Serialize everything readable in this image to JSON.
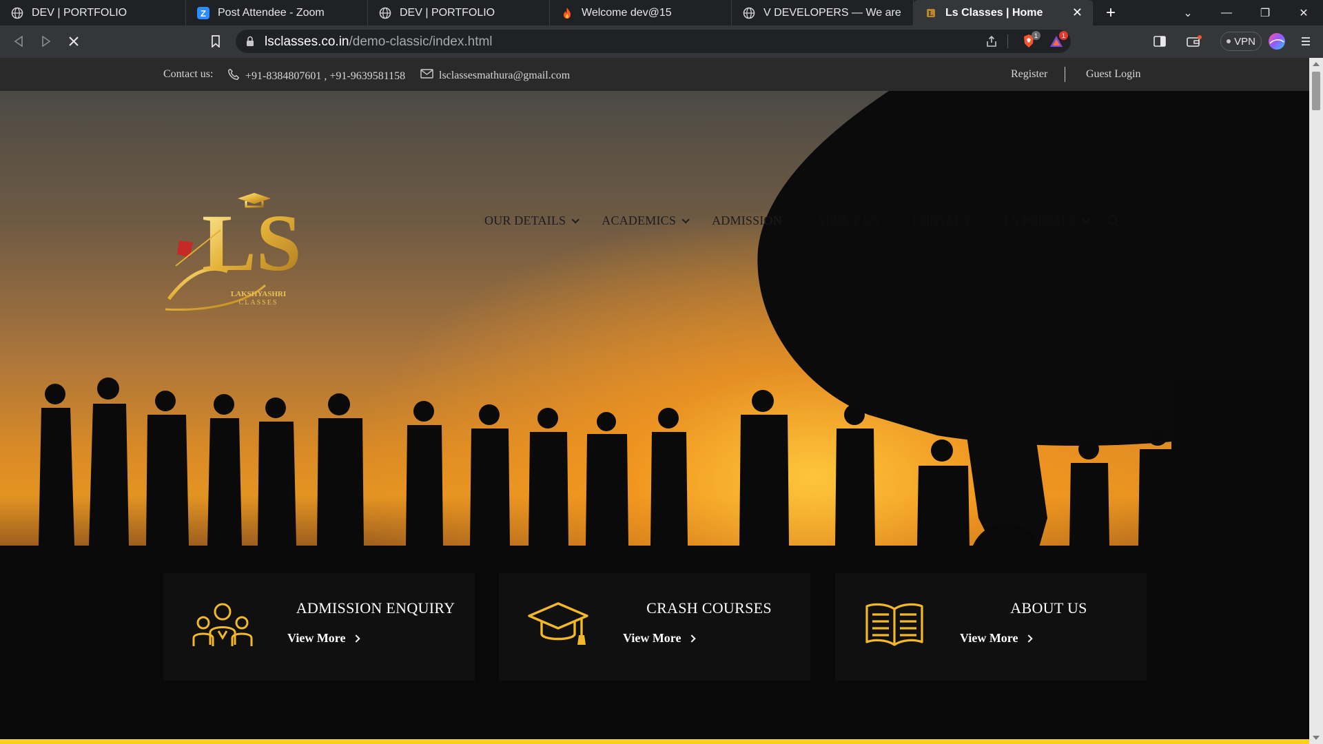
{
  "browser": {
    "tabs": [
      {
        "title": "DEV | PORTFOLIO",
        "icon": "globe-icon"
      },
      {
        "title": "Post Attendee - Zoom",
        "icon": "zoom-icon"
      },
      {
        "title": "DEV | PORTFOLIO",
        "icon": "globe-icon"
      },
      {
        "title": "Welcome dev@15",
        "icon": "flame-icon"
      },
      {
        "title": "V DEVELOPERS — We are the DE",
        "icon": "globe-icon"
      },
      {
        "title": "Ls Classes | Home",
        "icon": "ls-favicon-icon",
        "active": true
      }
    ],
    "url_host": "lsclasses.co.in",
    "url_path": "/demo-classic/index.html",
    "vpn_label": "VPN",
    "badges": {
      "brave_shields": "1",
      "rewards": "1"
    }
  },
  "topbar": {
    "contact_label": "Contact us:",
    "phones": "+91-8384807601 , +91-9639581158",
    "email": "lsclassesmathura@gmail.com",
    "register": "Register",
    "guest_login": "Guest Login"
  },
  "logo": {
    "line1": "LAKSHYASHRI",
    "line2": "CLASSES",
    "monogram": "LS"
  },
  "nav": {
    "items": [
      {
        "label": "OUR DETAILS",
        "dropdown": true
      },
      {
        "label": "ACADEMICS",
        "dropdown": true
      },
      {
        "label": "ADMISSION",
        "dropdown": false
      }
    ],
    "ghost_items": [
      "ABOUT US",
      "CONTACT",
      "LS PORTALS"
    ]
  },
  "cards": [
    {
      "title": "ADMISSION ENQUIRY",
      "link": "View More",
      "icon": "group-people-icon"
    },
    {
      "title": "CRASH COURSES",
      "link": "View More",
      "icon": "graduation-cap-icon"
    },
    {
      "title": "ABOUT US",
      "link": "View More",
      "icon": "open-book-icon"
    }
  ],
  "colors": {
    "accent": "#f2b829",
    "tab_active": "#35363a",
    "scroll_bottom_bar": "#ffd21a"
  }
}
